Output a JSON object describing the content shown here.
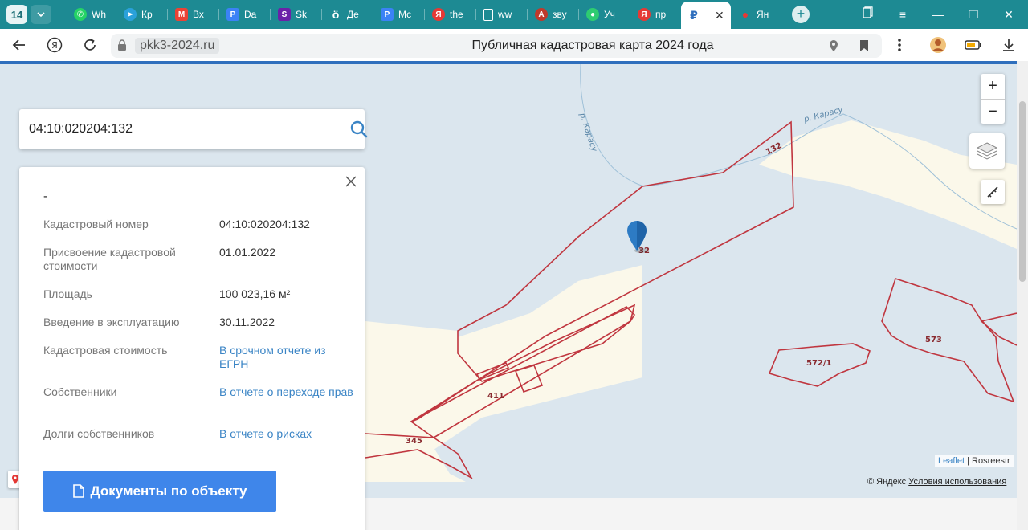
{
  "browser": {
    "tab_count": "14",
    "tabs": [
      {
        "label": "Wh",
        "icon": "whatsapp-icon",
        "color": "#25d366"
      },
      {
        "label": "Кр",
        "icon": "telegram-icon",
        "color": "#2aa1da"
      },
      {
        "label": "Вх",
        "icon": "gmail-icon",
        "color": "#ea4335"
      },
      {
        "label": "Da",
        "icon": "docs-icon",
        "color": "#3b82f6"
      },
      {
        "label": "Sk",
        "icon": "skillbox-icon",
        "color": "#6b21a8"
      },
      {
        "label": "Де",
        "icon": "search-o-icon",
        "color": "#222222"
      },
      {
        "label": "Мс",
        "icon": "docs-icon",
        "color": "#3b82f6"
      },
      {
        "label": "the",
        "icon": "yandex-icon",
        "color": "#e53935"
      },
      {
        "label": "ww",
        "icon": "page-icon",
        "color": "#ffffff"
      },
      {
        "label": "зву",
        "icon": "audio-icon",
        "color": "#c0392b"
      },
      {
        "label": "Уч",
        "icon": "apps-icon",
        "color": "#2ecc71"
      },
      {
        "label": "пр",
        "icon": "yandex-icon",
        "color": "#e53935"
      },
      {
        "label": "",
        "icon": "pkk-icon",
        "color": "#2f6fbd",
        "active": true
      },
      {
        "label": "Ян",
        "icon": "maps-pin-icon",
        "color": "#e53935"
      }
    ],
    "url": "pkk3-2024.ru",
    "page_title": "Публичная кадастровая карта 2024 года"
  },
  "search": {
    "value": "04:10:020204:132"
  },
  "info": {
    "title": "-",
    "rows": [
      {
        "label": "Кадастровый номер",
        "value": "04:10:020204:132"
      },
      {
        "label": "Присвоение кадастровой стоимости",
        "value": "01.01.2022"
      },
      {
        "label": "Площадь",
        "value": "100 023,16 м²"
      },
      {
        "label": "Введение в эксплуатацию",
        "value": "30.11.2022"
      },
      {
        "label": "Кадастровая стоимость",
        "value": "В срочном отчете из ЕГРН"
      },
      {
        "label": "Собственники",
        "value": "В отчете о переходе прав"
      },
      {
        "label": "Долги собственников",
        "value": "В отчете о рисках"
      }
    ],
    "docs_button": "Документы по объекту"
  },
  "map": {
    "river_label_1": "р. Карасу",
    "river_label_2": "р. Карасу",
    "parcel_labels": [
      "132",
      "32",
      "411",
      "345",
      "572/1",
      "573"
    ],
    "zoom_in": "+",
    "zoom_out": "−",
    "attribution_leaflet": "Leaflet",
    "attribution_sep": " | ",
    "attribution_rosreestr": "Rosreestr",
    "yandex_copyright": "© Яндекс",
    "yandex_terms": "Условия использования",
    "colors": {
      "water": "#dbe6ee",
      "land": "#fbf8ea",
      "parcel": "#c0363f"
    }
  }
}
